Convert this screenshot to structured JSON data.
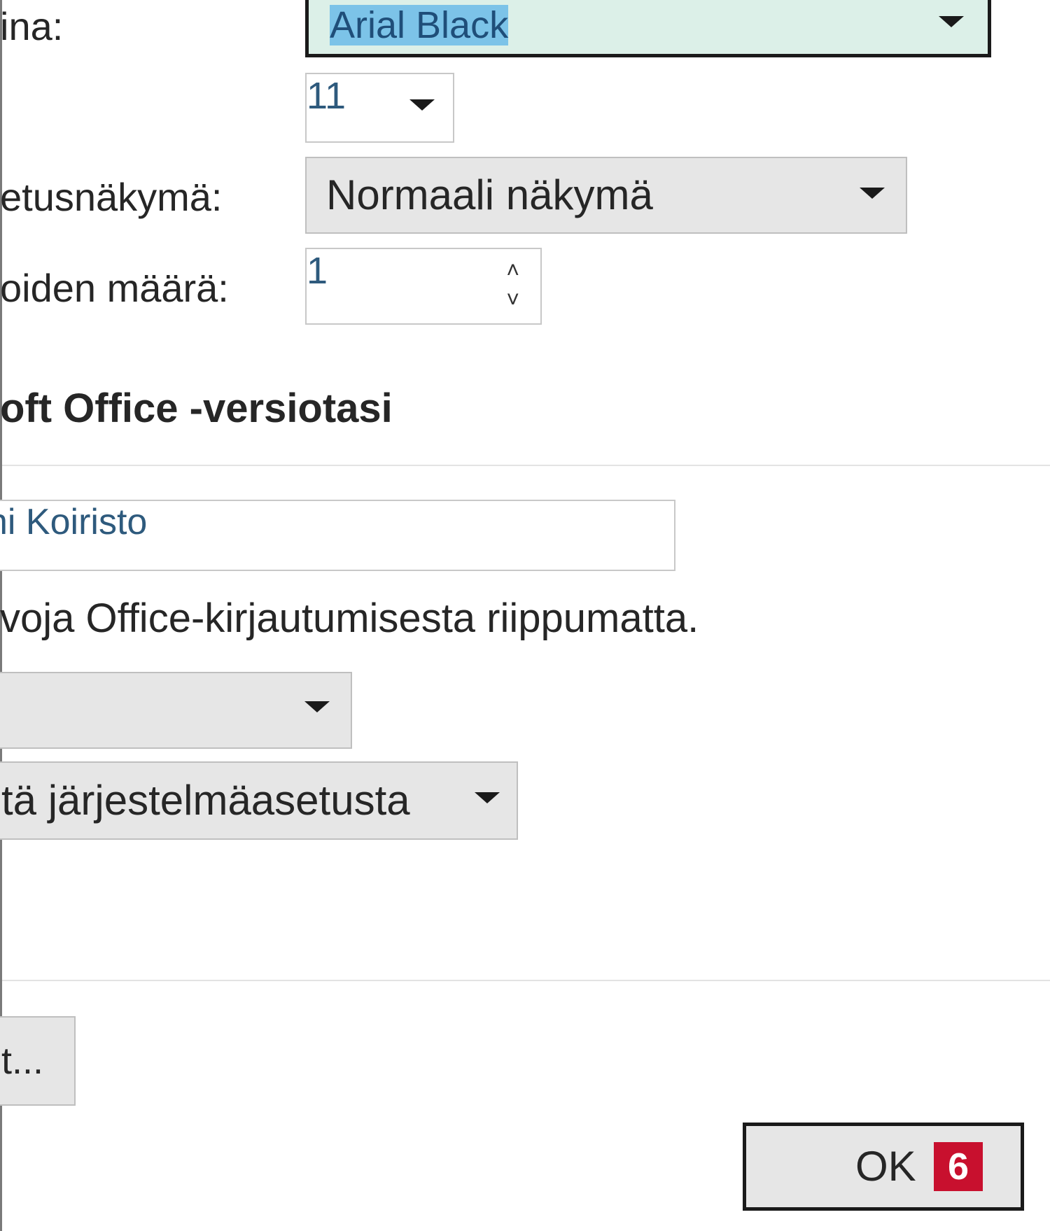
{
  "labels": {
    "font": "ina:",
    "default_view": "etusnäkymä:",
    "count": "oiden määrä:"
  },
  "font_combo": {
    "value": "Arial Black"
  },
  "size_combo": {
    "value": "11"
  },
  "view_combo": {
    "value": "Normaali näkymä"
  },
  "count_spin": {
    "value": "1"
  },
  "section": {
    "title": "oft Office -versiotasi"
  },
  "username_field": {
    "value": "ni Koiristo"
  },
  "info_text": "voja Office-kirjautumisesta riippumatta.",
  "combo_a": {
    "value": ""
  },
  "combo_b": {
    "value": "tä järjestelmäasetusta"
  },
  "partial_button": {
    "label": "t..."
  },
  "ok_button": {
    "label": "OK",
    "step_number": "6"
  },
  "colors": {
    "selection_highlight": "#7cc3e8",
    "focused_field_bg": "#dcf0e8",
    "badge_red": "#c8102e",
    "value_blue": "#2e5a7d"
  },
  "icons": {
    "dropdown": "caret-down-icon",
    "spin_up": "chevron-up-icon",
    "spin_down": "chevron-down-icon"
  }
}
